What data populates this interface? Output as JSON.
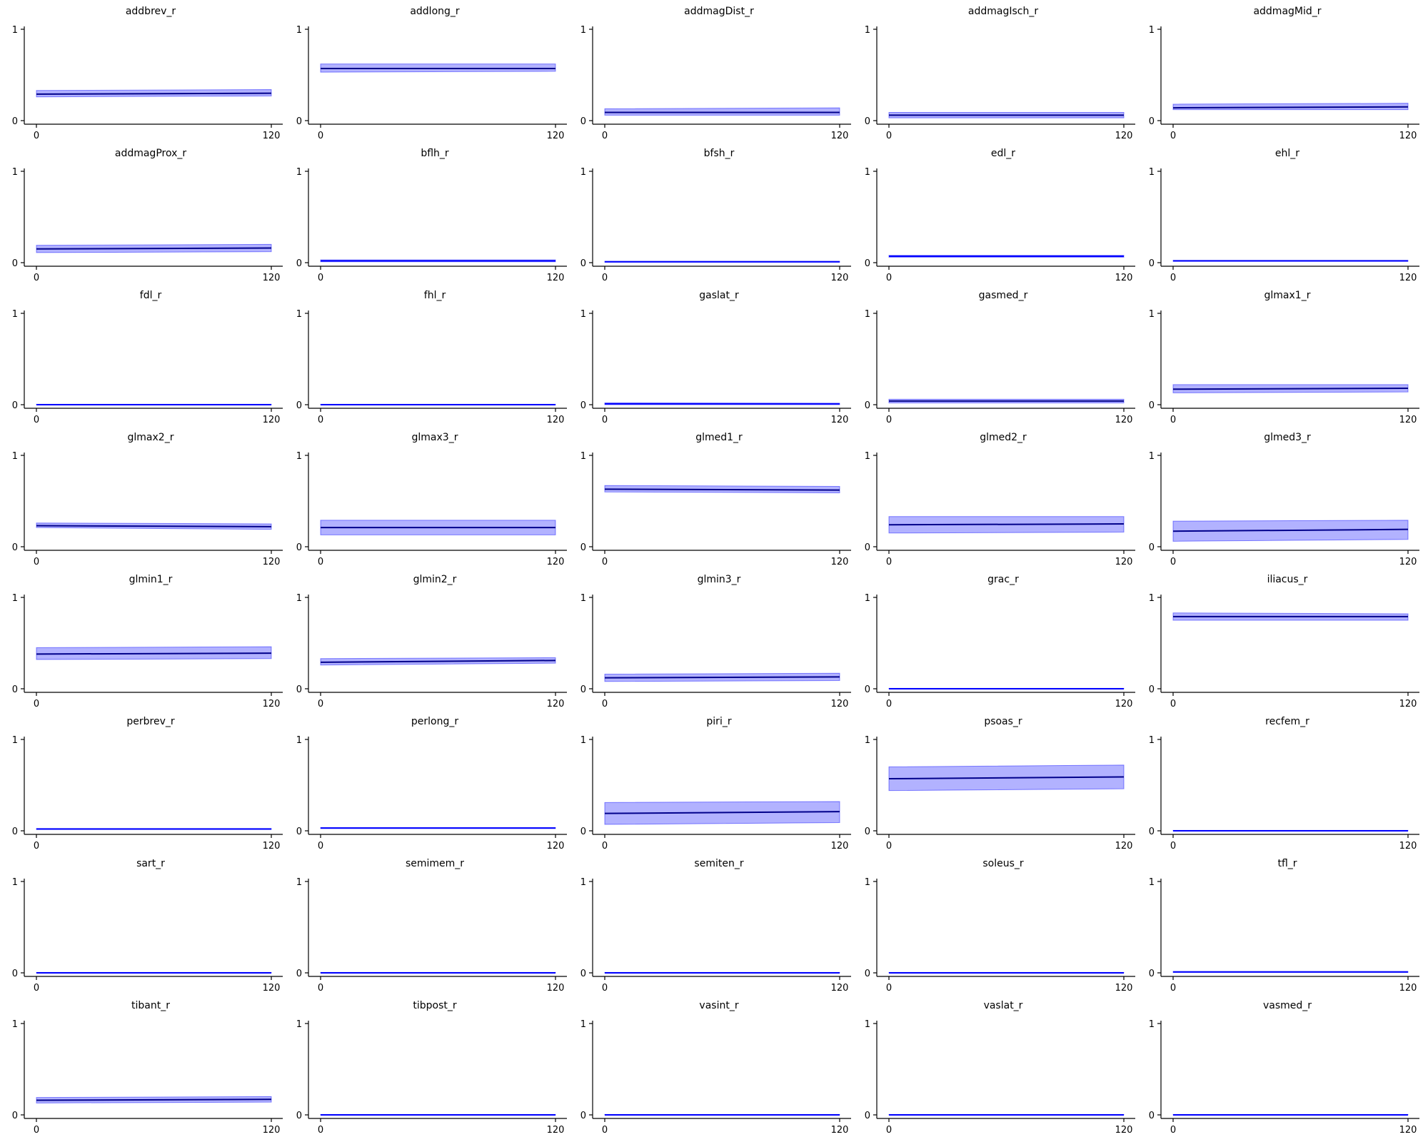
{
  "chart_data": {
    "type": "line",
    "layout": {
      "rows": 8,
      "cols": 5
    },
    "shared": {
      "xlim": [
        0,
        120
      ],
      "ylim": [
        0,
        1
      ],
      "xticks": [
        0,
        120
      ],
      "yticks": [
        0,
        1
      ],
      "mean_color": "#0000ff",
      "band_color": "#0000ff",
      "band_alpha": 0.3,
      "grid": false
    },
    "panels": [
      {
        "title": "addbrev_r",
        "x": [
          0,
          120
        ],
        "mean": [
          0.29,
          0.3
        ],
        "lower": [
          0.26,
          0.27
        ],
        "upper": [
          0.33,
          0.34
        ],
        "mean_color": "#00008b"
      },
      {
        "title": "addlong_r",
        "x": [
          0,
          120
        ],
        "mean": [
          0.57,
          0.57
        ],
        "lower": [
          0.53,
          0.54
        ],
        "upper": [
          0.62,
          0.62
        ],
        "mean_color": "#00008b"
      },
      {
        "title": "addmagDist_r",
        "x": [
          0,
          120
        ],
        "mean": [
          0.09,
          0.09
        ],
        "lower": [
          0.06,
          0.06
        ],
        "upper": [
          0.13,
          0.14
        ],
        "mean_color": "#00008b"
      },
      {
        "title": "addmagIsch_r",
        "x": [
          0,
          120
        ],
        "mean": [
          0.06,
          0.06
        ],
        "lower": [
          0.03,
          0.03
        ],
        "upper": [
          0.09,
          0.09
        ],
        "mean_color": "#00008b"
      },
      {
        "title": "addmagMid_r",
        "x": [
          0,
          120
        ],
        "mean": [
          0.14,
          0.15
        ],
        "lower": [
          0.12,
          0.12
        ],
        "upper": [
          0.18,
          0.19
        ],
        "mean_color": "#00008b"
      },
      {
        "title": "addmagProx_r",
        "x": [
          0,
          120
        ],
        "mean": [
          0.15,
          0.16
        ],
        "lower": [
          0.11,
          0.12
        ],
        "upper": [
          0.19,
          0.2
        ],
        "mean_color": "#00008b"
      },
      {
        "title": "bflh_r",
        "x": [
          0,
          120
        ],
        "mean": [
          0.02,
          0.02
        ],
        "lower": [
          0.01,
          0.01
        ],
        "upper": [
          0.03,
          0.03
        ],
        "mean_color": "#0000ff"
      },
      {
        "title": "bfsh_r",
        "x": [
          0,
          120
        ],
        "mean": [
          0.01,
          0.01
        ],
        "lower": [
          0.005,
          0.005
        ],
        "upper": [
          0.015,
          0.015
        ],
        "mean_color": "#0000ff"
      },
      {
        "title": "edl_r",
        "x": [
          0,
          120
        ],
        "mean": [
          0.07,
          0.07
        ],
        "lower": [
          0.06,
          0.06
        ],
        "upper": [
          0.08,
          0.08
        ],
        "mean_color": "#0000ff"
      },
      {
        "title": "ehl_r",
        "x": [
          0,
          120
        ],
        "mean": [
          0.02,
          0.02
        ],
        "lower": [
          0.015,
          0.015
        ],
        "upper": [
          0.025,
          0.025
        ],
        "mean_color": "#0000ff"
      },
      {
        "title": "fdl_r",
        "x": [
          0,
          120
        ],
        "mean": [
          0.0,
          0.0
        ],
        "lower": [
          0.0,
          0.0
        ],
        "upper": [
          0.005,
          0.005
        ],
        "mean_color": "#0000ff"
      },
      {
        "title": "fhl_r",
        "x": [
          0,
          120
        ],
        "mean": [
          0.0,
          0.0
        ],
        "lower": [
          0.0,
          0.0
        ],
        "upper": [
          0.005,
          0.005
        ],
        "mean_color": "#0000ff"
      },
      {
        "title": "gaslat_r",
        "x": [
          0,
          120
        ],
        "mean": [
          0.01,
          0.01
        ],
        "lower": [
          0.0,
          0.0
        ],
        "upper": [
          0.02,
          0.015
        ],
        "mean_color": "#0000ff"
      },
      {
        "title": "gasmed_r",
        "x": [
          0,
          120
        ],
        "mean": [
          0.04,
          0.04
        ],
        "lower": [
          0.02,
          0.02
        ],
        "upper": [
          0.06,
          0.06
        ],
        "mean_color": "#00008b"
      },
      {
        "title": "glmax1_r",
        "x": [
          0,
          120
        ],
        "mean": [
          0.17,
          0.18
        ],
        "lower": [
          0.13,
          0.14
        ],
        "upper": [
          0.22,
          0.22
        ],
        "mean_color": "#00008b"
      },
      {
        "title": "glmax2_r",
        "x": [
          0,
          120
        ],
        "mean": [
          0.23,
          0.22
        ],
        "lower": [
          0.21,
          0.19
        ],
        "upper": [
          0.26,
          0.25
        ],
        "mean_color": "#00008b"
      },
      {
        "title": "glmax3_r",
        "x": [
          0,
          120
        ],
        "mean": [
          0.21,
          0.21
        ],
        "lower": [
          0.13,
          0.13
        ],
        "upper": [
          0.29,
          0.29
        ],
        "mean_color": "#00008b"
      },
      {
        "title": "glmed1_r",
        "x": [
          0,
          120
        ],
        "mean": [
          0.63,
          0.62
        ],
        "lower": [
          0.6,
          0.59
        ],
        "upper": [
          0.67,
          0.66
        ],
        "mean_color": "#00008b"
      },
      {
        "title": "glmed2_r",
        "x": [
          0,
          120
        ],
        "mean": [
          0.24,
          0.25
        ],
        "lower": [
          0.15,
          0.16
        ],
        "upper": [
          0.33,
          0.33
        ],
        "mean_color": "#00008b"
      },
      {
        "title": "glmed3_r",
        "x": [
          0,
          120
        ],
        "mean": [
          0.17,
          0.19
        ],
        "lower": [
          0.06,
          0.08
        ],
        "upper": [
          0.28,
          0.29
        ],
        "mean_color": "#00008b"
      },
      {
        "title": "glmin1_r",
        "x": [
          0,
          120
        ],
        "mean": [
          0.38,
          0.39
        ],
        "lower": [
          0.32,
          0.33
        ],
        "upper": [
          0.45,
          0.46
        ],
        "mean_color": "#00008b"
      },
      {
        "title": "glmin2_r",
        "x": [
          0,
          120
        ],
        "mean": [
          0.29,
          0.31
        ],
        "lower": [
          0.26,
          0.28
        ],
        "upper": [
          0.33,
          0.34
        ],
        "mean_color": "#00008b"
      },
      {
        "title": "glmin3_r",
        "x": [
          0,
          120
        ],
        "mean": [
          0.12,
          0.13
        ],
        "lower": [
          0.08,
          0.09
        ],
        "upper": [
          0.16,
          0.17
        ],
        "mean_color": "#00008b"
      },
      {
        "title": "grac_r",
        "x": [
          0,
          120
        ],
        "mean": [
          0.0,
          0.0
        ],
        "lower": [
          0.0,
          0.0
        ],
        "upper": [
          0.005,
          0.005
        ],
        "mean_color": "#0000ff"
      },
      {
        "title": "iliacus_r",
        "x": [
          0,
          120
        ],
        "mean": [
          0.79,
          0.79
        ],
        "lower": [
          0.75,
          0.75
        ],
        "upper": [
          0.83,
          0.82
        ],
        "mean_color": "#00008b"
      },
      {
        "title": "perbrev_r",
        "x": [
          0,
          120
        ],
        "mean": [
          0.02,
          0.02
        ],
        "lower": [
          0.015,
          0.015
        ],
        "upper": [
          0.025,
          0.025
        ],
        "mean_color": "#0000ff"
      },
      {
        "title": "perlong_r",
        "x": [
          0,
          120
        ],
        "mean": [
          0.03,
          0.03
        ],
        "lower": [
          0.025,
          0.025
        ],
        "upper": [
          0.035,
          0.035
        ],
        "mean_color": "#0000ff"
      },
      {
        "title": "piri_r",
        "x": [
          0,
          120
        ],
        "mean": [
          0.19,
          0.21
        ],
        "lower": [
          0.07,
          0.09
        ],
        "upper": [
          0.31,
          0.32
        ],
        "mean_color": "#00008b"
      },
      {
        "title": "psoas_r",
        "x": [
          0,
          120
        ],
        "mean": [
          0.57,
          0.59
        ],
        "lower": [
          0.44,
          0.46
        ],
        "upper": [
          0.7,
          0.72
        ],
        "mean_color": "#00008b"
      },
      {
        "title": "recfem_r",
        "x": [
          0,
          120
        ],
        "mean": [
          0.0,
          0.0
        ],
        "lower": [
          0.0,
          0.0
        ],
        "upper": [
          0.005,
          0.005
        ],
        "mean_color": "#0000ff"
      },
      {
        "title": "sart_r",
        "x": [
          0,
          120
        ],
        "mean": [
          0.0,
          0.0
        ],
        "lower": [
          0.0,
          0.0
        ],
        "upper": [
          0.005,
          0.005
        ],
        "mean_color": "#0000ff"
      },
      {
        "title": "semimem_r",
        "x": [
          0,
          120
        ],
        "mean": [
          0.0,
          0.0
        ],
        "lower": [
          0.0,
          0.0
        ],
        "upper": [
          0.005,
          0.005
        ],
        "mean_color": "#0000ff"
      },
      {
        "title": "semiten_r",
        "x": [
          0,
          120
        ],
        "mean": [
          0.0,
          0.0
        ],
        "lower": [
          0.0,
          0.0
        ],
        "upper": [
          0.005,
          0.005
        ],
        "mean_color": "#0000ff"
      },
      {
        "title": "soleus_r",
        "x": [
          0,
          120
        ],
        "mean": [
          0.0,
          0.0
        ],
        "lower": [
          0.0,
          0.0
        ],
        "upper": [
          0.005,
          0.005
        ],
        "mean_color": "#0000ff"
      },
      {
        "title": "tfl_r",
        "x": [
          0,
          120
        ],
        "mean": [
          0.01,
          0.01
        ],
        "lower": [
          0.005,
          0.005
        ],
        "upper": [
          0.015,
          0.015
        ],
        "mean_color": "#0000ff"
      },
      {
        "title": "tibant_r",
        "x": [
          0,
          120
        ],
        "mean": [
          0.16,
          0.17
        ],
        "lower": [
          0.13,
          0.14
        ],
        "upper": [
          0.19,
          0.2
        ],
        "mean_color": "#00008b"
      },
      {
        "title": "tibpost_r",
        "x": [
          0,
          120
        ],
        "mean": [
          0.0,
          0.0
        ],
        "lower": [
          0.0,
          0.0
        ],
        "upper": [
          0.005,
          0.005
        ],
        "mean_color": "#0000ff"
      },
      {
        "title": "vasint_r",
        "x": [
          0,
          120
        ],
        "mean": [
          0.0,
          0.0
        ],
        "lower": [
          0.0,
          0.0
        ],
        "upper": [
          0.005,
          0.005
        ],
        "mean_color": "#0000ff"
      },
      {
        "title": "vaslat_r",
        "x": [
          0,
          120
        ],
        "mean": [
          0.0,
          0.0
        ],
        "lower": [
          0.0,
          0.0
        ],
        "upper": [
          0.005,
          0.005
        ],
        "mean_color": "#0000ff"
      },
      {
        "title": "vasmed_r",
        "x": [
          0,
          120
        ],
        "mean": [
          0.0,
          0.0
        ],
        "lower": [
          0.0,
          0.0
        ],
        "upper": [
          0.005,
          0.005
        ],
        "mean_color": "#0000ff"
      }
    ]
  }
}
